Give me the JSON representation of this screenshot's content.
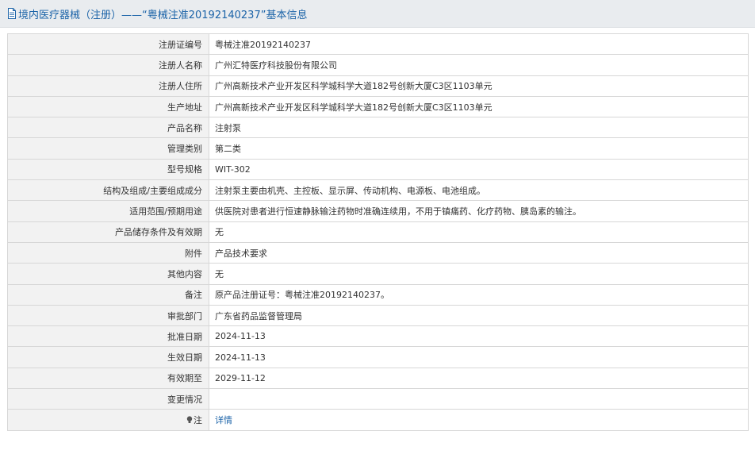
{
  "header": {
    "icon": "document-icon",
    "title": "境内医疗器械（注册）——“粤械注准20192140237”基本信息"
  },
  "rows": [
    {
      "label": "注册证编号",
      "value": "粤械注准20192140237"
    },
    {
      "label": "注册人名称",
      "value": "广州汇特医疗科技股份有限公司"
    },
    {
      "label": "注册人住所",
      "value": "广州高新技术产业开发区科学城科学大道182号创新大厦C3区1103单元"
    },
    {
      "label": "生产地址",
      "value": "广州高新技术产业开发区科学城科学大道182号创新大厦C3区1103单元"
    },
    {
      "label": "产品名称",
      "value": "注射泵"
    },
    {
      "label": "管理类别",
      "value": "第二类"
    },
    {
      "label": "型号规格",
      "value": "WIT-302"
    },
    {
      "label": "结构及组成/主要组成成分",
      "value": "注射泵主要由机壳、主控板、显示屏、传动机构、电源板、电池组成。"
    },
    {
      "label": "适用范围/预期用途",
      "value": "供医院对患者进行恒速静脉输注药物时准确连续用，不用于镇痛药、化疗药物、胰岛素的输注。"
    },
    {
      "label": "产品储存条件及有效期",
      "value": "无"
    },
    {
      "label": "附件",
      "value": "产品技术要求"
    },
    {
      "label": "其他内容",
      "value": "无"
    },
    {
      "label": "备注",
      "value": "原产品注册证号：粤械注准20192140237。"
    },
    {
      "label": "审批部门",
      "value": "广东省药品监督管理局"
    },
    {
      "label": "批准日期",
      "value": "2024-11-13"
    },
    {
      "label": "生效日期",
      "value": "2024-11-13"
    },
    {
      "label": "有效期至",
      "value": "2029-11-12"
    },
    {
      "label": "变更情况",
      "value": ""
    }
  ],
  "note_row": {
    "icon": "bulb-icon",
    "label": "注",
    "link": "详情"
  }
}
